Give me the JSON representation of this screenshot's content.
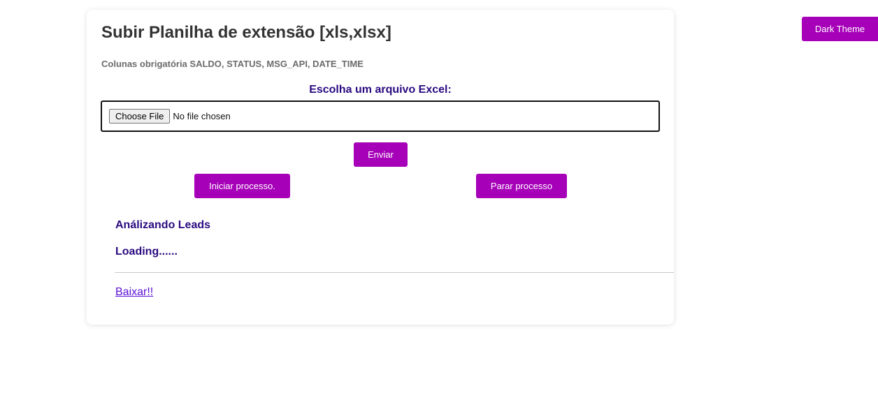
{
  "header": {
    "title": "Subir Planilha de extensão [xls,xlsx]",
    "subtitle": "Colunas obrigatória SALDO, STATUS, MSG_API, DATE_TIME"
  },
  "upload": {
    "label": "Escolha um arquivo Excel:",
    "choose_button": "Choose File",
    "no_file_text": "No file chosen"
  },
  "actions": {
    "send_label": "Enviar",
    "start_label": "Iniciar processo.",
    "stop_label": "Parar processo"
  },
  "status": {
    "analyzing": "Análizando Leads",
    "loading": "Loading......"
  },
  "download": {
    "link_text": "Baixar!!"
  },
  "theme": {
    "toggle_label": "Dark Theme"
  },
  "colors": {
    "accent": "#a600b8",
    "heading_purple": "#2a0a80",
    "link": "#5a0fd6"
  }
}
